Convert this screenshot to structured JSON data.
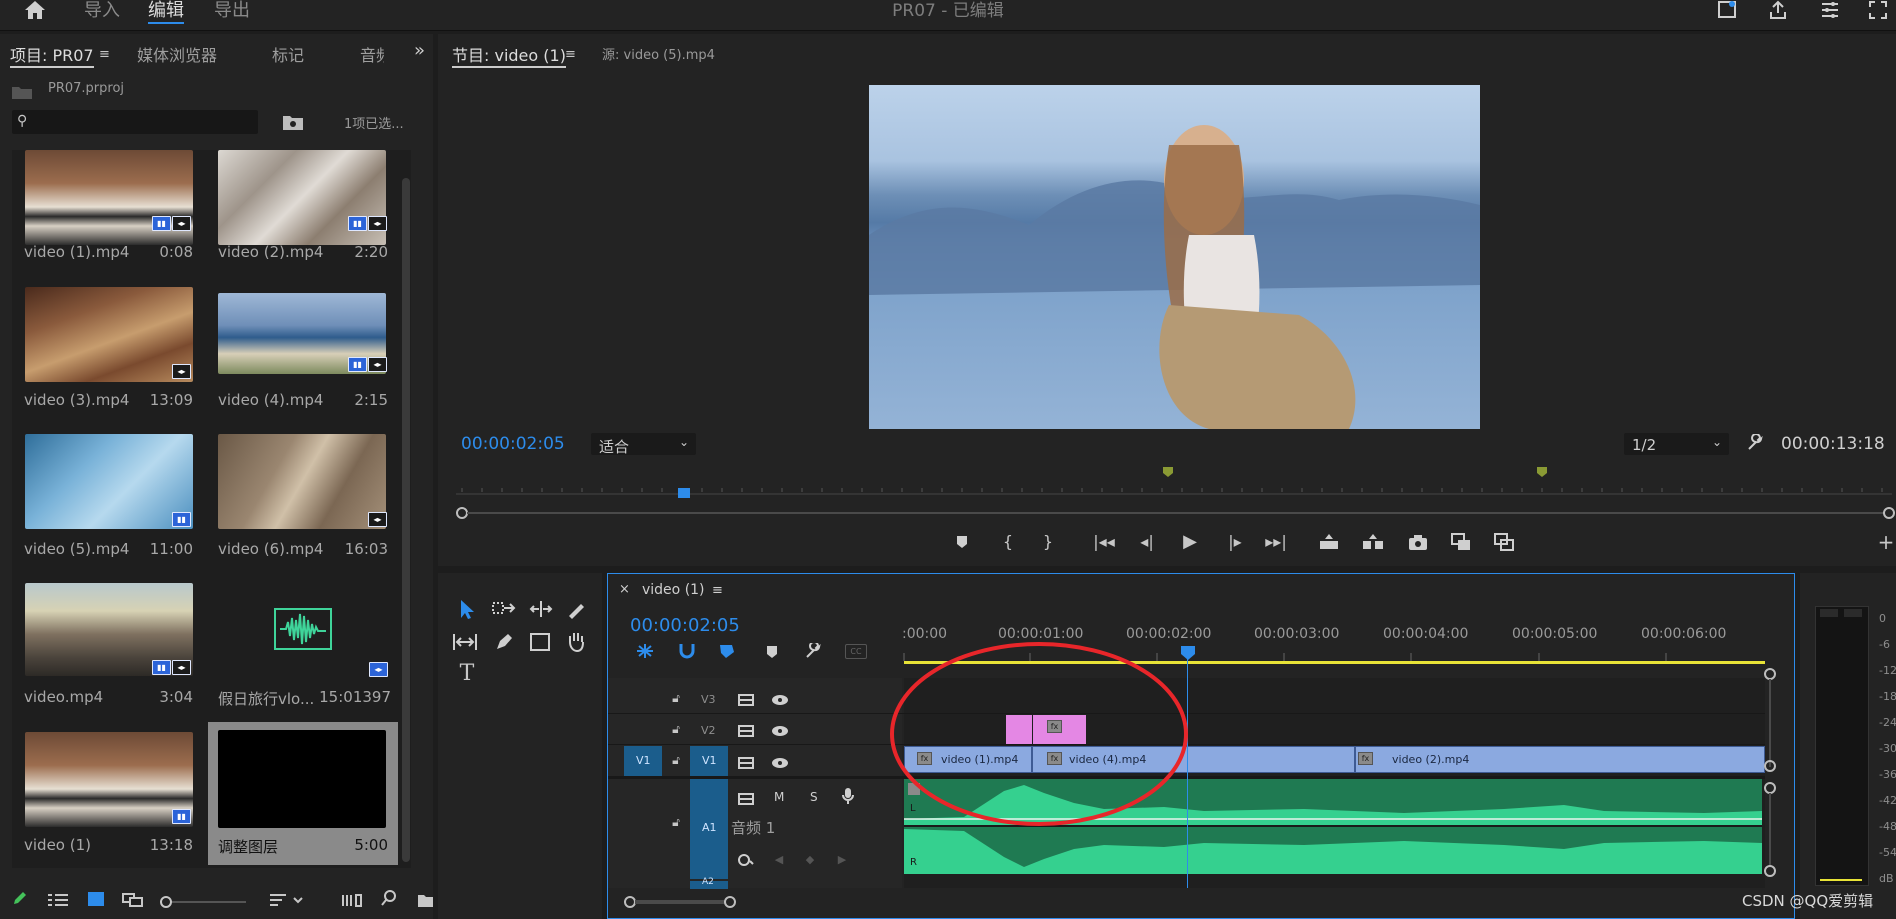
{
  "header": {
    "home_icon": "home-icon",
    "nav": [
      "导入",
      "编辑",
      "导出"
    ],
    "title": "PR07 - 已编辑"
  },
  "project_panel": {
    "tabs": [
      "项目: PR07",
      "媒体浏览器",
      "标记",
      "音频"
    ],
    "project_file": "PR07.prproj",
    "search_placeholder": "",
    "selection_status": "1项已选...",
    "items": [
      {
        "name": "video (1).mp4",
        "duration": "0:08"
      },
      {
        "name": "video (2).mp4",
        "duration": "2:20"
      },
      {
        "name": "video (3).mp4",
        "duration": "13:09"
      },
      {
        "name": "video (4).mp4",
        "duration": "2:15"
      },
      {
        "name": "video (5).mp4",
        "duration": "11:00"
      },
      {
        "name": "video (6).mp4",
        "duration": "16:03"
      },
      {
        "name": "video.mp4",
        "duration": "3:04"
      },
      {
        "name": "假日旅行vlo...",
        "duration": "15:01397"
      },
      {
        "name": "video (1)",
        "duration": "13:18"
      },
      {
        "name": "调整图层",
        "duration": "5:00"
      }
    ]
  },
  "program_monitor": {
    "tab_program": "节目: video (1)",
    "tab_source": "源: video (5).mp4",
    "timecode": "00:00:02:05",
    "fit_option": "适合",
    "resolution_option": "1/2",
    "duration": "00:00:13:18"
  },
  "timeline": {
    "sequence_name": "video (1)",
    "timecode": "00:00:02:05",
    "ruler": [
      ":00:00",
      "00:00:01:00",
      "00:00:02:00",
      "00:00:03:00",
      "00:00:04:00",
      "00:00:05:00",
      "00:00:06:00"
    ],
    "tracks": {
      "v3": "V3",
      "v2": "V2",
      "v1": "V1",
      "v1_source": "V1",
      "a1": "A1",
      "a2": "A2",
      "audio_name": "音频 1",
      "mute": "M",
      "solo": "S"
    },
    "clips": [
      {
        "name": "video (1).mp4"
      },
      {
        "name": "video (4).mp4"
      },
      {
        "name": "video (2).mp4"
      }
    ]
  },
  "audio_meter": {
    "scale": [
      "0",
      "-6",
      "-12",
      "-18",
      "-24",
      "-30",
      "-36",
      "-42",
      "-48",
      "-54",
      "dB"
    ]
  },
  "watermark": "CSDN @QQ爱剪辑"
}
